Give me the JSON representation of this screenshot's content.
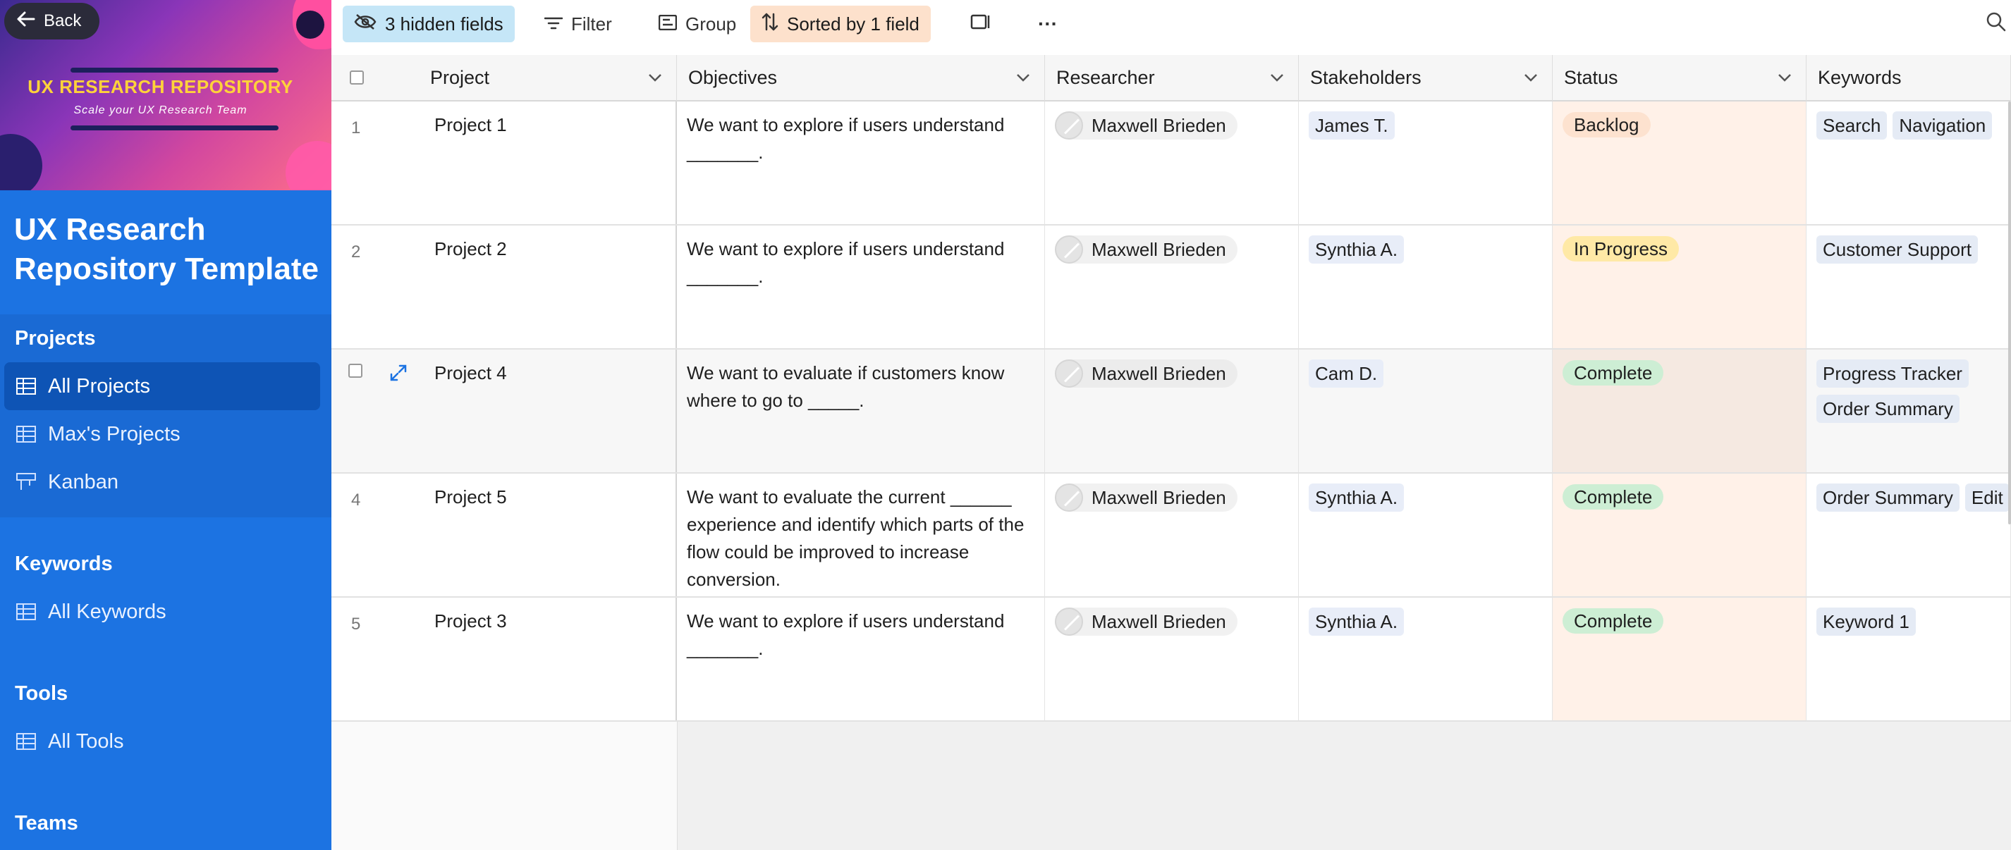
{
  "sidebar": {
    "back_label": "Back",
    "banner_title": "UX RESEARCH REPOSITORY",
    "banner_subtitle": "Scale your UX Research Team",
    "heading": "UX Research Repository Template",
    "groups": [
      {
        "title": "Projects",
        "items": [
          {
            "label": "All Projects",
            "icon": "grid-icon",
            "active": true
          },
          {
            "label": "Max's Projects",
            "icon": "grid-icon"
          },
          {
            "label": "Kanban",
            "icon": "kanban-icon"
          }
        ]
      },
      {
        "title": "Keywords",
        "items": [
          {
            "label": "All Keywords",
            "icon": "grid-icon"
          }
        ]
      },
      {
        "title": "Tools",
        "items": [
          {
            "label": "All Tools",
            "icon": "grid-icon"
          }
        ]
      },
      {
        "title": "Teams",
        "items": []
      }
    ]
  },
  "toolbar": {
    "hidden_fields": "3 hidden fields",
    "filter": "Filter",
    "group": "Group",
    "sorted": "Sorted by 1 field",
    "more": "···"
  },
  "columns": [
    "Project",
    "Objectives",
    "Researcher",
    "Stakeholders",
    "Status",
    "Keywords"
  ],
  "rows": [
    {
      "num": "1",
      "project": "Project 1",
      "objective": "We want to explore if users understand _______.",
      "researcher": "Maxwell Brieden",
      "stakeholder": "James T.",
      "status": "Backlog",
      "keywords": [
        "Search",
        "Navigation"
      ]
    },
    {
      "num": "2",
      "project": "Project 2",
      "objective": "We want to explore if users understand _______.",
      "researcher": "Maxwell Brieden",
      "stakeholder": "Synthia A.",
      "status": "In Progress",
      "keywords": [
        "Customer Support"
      ]
    },
    {
      "num": "",
      "project": "Project 4",
      "objective": "We want to evaluate if customers know where to go to _____.",
      "researcher": "Maxwell Brieden",
      "stakeholder": "Cam D.",
      "status": "Complete",
      "keywords": [
        "Progress Tracker",
        "Order Summary"
      ]
    },
    {
      "num": "4",
      "project": "Project 5",
      "objective": "We want to evaluate the current ______ experience and identify which parts of the flow could be improved to increase conversion.",
      "researcher": "Maxwell Brieden",
      "stakeholder": "Synthia A.",
      "status": "Complete",
      "keywords": [
        "Order Summary",
        "Edit"
      ]
    },
    {
      "num": "5",
      "project": "Project 3",
      "objective": "We want to explore if users understand _______.",
      "researcher": "Maxwell Brieden",
      "stakeholder": "Synthia A.",
      "status": "Complete",
      "keywords": [
        "Keyword 1"
      ]
    }
  ],
  "colors": {
    "sidebar": "#1c73e2",
    "hidden_fields_bg": "#c5e6f7",
    "sorted_bg": "#fde1cc",
    "status_complete": "#cdeed4",
    "status_in_progress": "#ffe9a6",
    "status_backlog": "#fde2cf"
  }
}
